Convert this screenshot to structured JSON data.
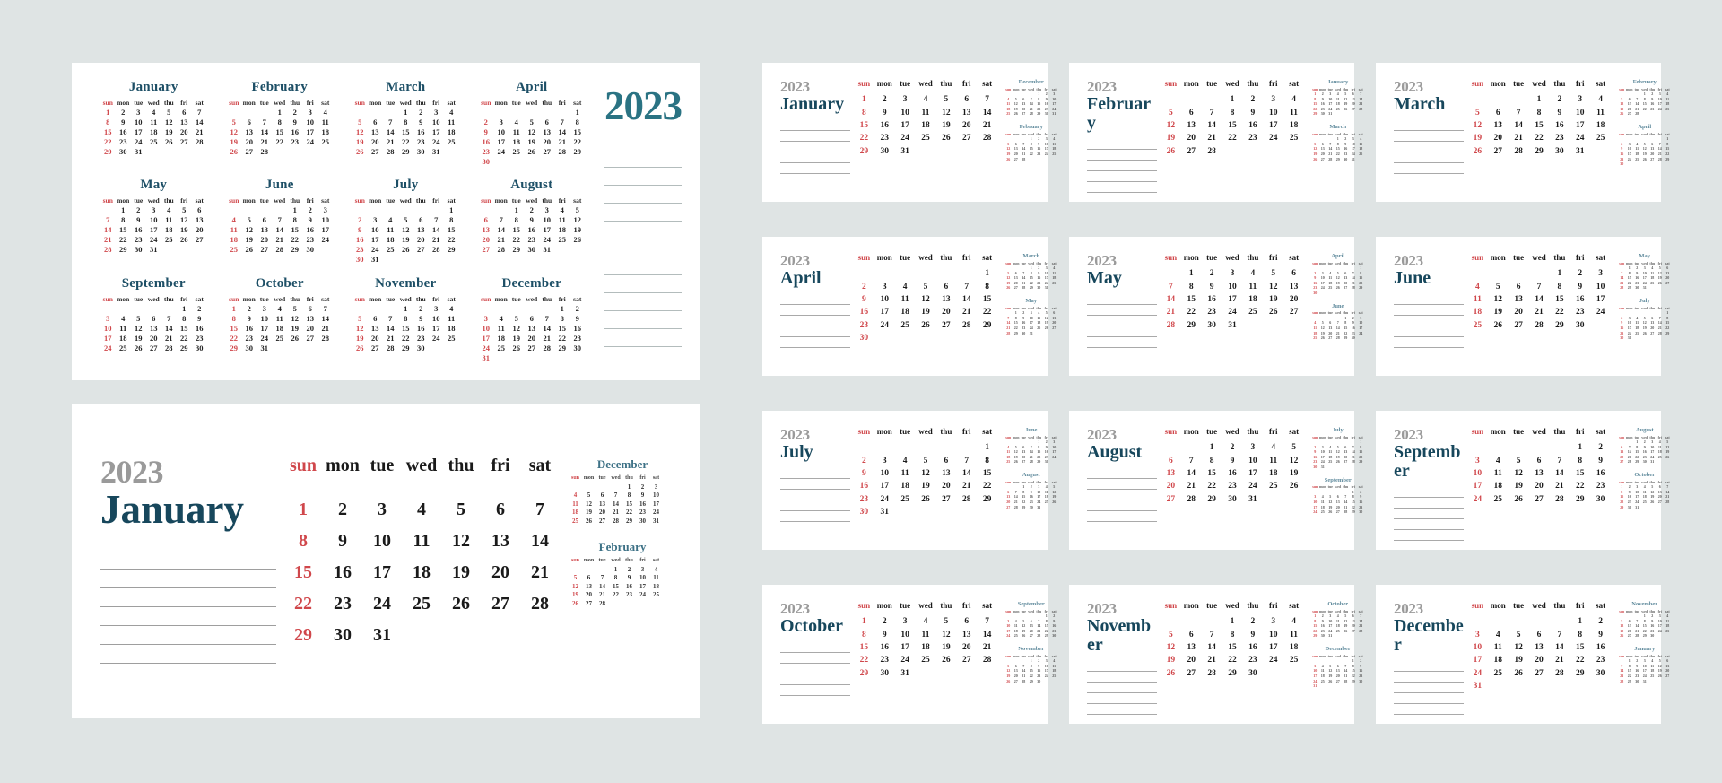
{
  "meta": {
    "year": "2023",
    "background_color": "#dfe4e4",
    "card_color": "#ffffff",
    "accent_teal": "#2a7383",
    "month_title_color": "#17475c",
    "year_gray": "#9a9a9a",
    "sunday_red": "#d0474b"
  },
  "weekday_labels": [
    "sun",
    "mon",
    "tue",
    "wed",
    "thu",
    "fri",
    "sat"
  ],
  "year_overview": {
    "year_label": "2023",
    "note_line_count": 11,
    "months": [
      {
        "name": "January",
        "start": 0,
        "days": 31
      },
      {
        "name": "February",
        "start": 3,
        "days": 28
      },
      {
        "name": "March",
        "start": 3,
        "days": 31
      },
      {
        "name": "April",
        "start": 6,
        "days": 30
      },
      {
        "name": "May",
        "start": 1,
        "days": 31
      },
      {
        "name": "June",
        "start": 4,
        "days": 30
      },
      {
        "name": "July",
        "start": 6,
        "days": 31
      },
      {
        "name": "August",
        "start": 2,
        "days": 31
      },
      {
        "name": "September",
        "start": 5,
        "days": 30
      },
      {
        "name": "October",
        "start": 0,
        "days": 31
      },
      {
        "name": "November",
        "start": 3,
        "days": 30
      },
      {
        "name": "December",
        "start": 5,
        "days": 31
      }
    ]
  },
  "big_month": {
    "year_label": "2023",
    "month_label": "January",
    "start": 0,
    "days": 31,
    "note_line_count": 6,
    "side_calendars": [
      {
        "name": "December",
        "start": 4,
        "days": 31
      },
      {
        "name": "February",
        "start": 3,
        "days": 28
      }
    ]
  },
  "month_cards": [
    {
      "year_label": "2023",
      "month_label": "January",
      "start": 0,
      "days": 31,
      "note_line_count": 5,
      "side_calendars": [
        {
          "name": "December",
          "start": 4,
          "days": 31
        },
        {
          "name": "February",
          "start": 3,
          "days": 28
        }
      ]
    },
    {
      "year_label": "2023",
      "month_label": "February",
      "start": 3,
      "days": 28,
      "note_line_count": 5,
      "side_calendars": [
        {
          "name": "January",
          "start": 0,
          "days": 31
        },
        {
          "name": "March",
          "start": 3,
          "days": 31
        }
      ]
    },
    {
      "year_label": "2023",
      "month_label": "March",
      "start": 3,
      "days": 31,
      "note_line_count": 5,
      "side_calendars": [
        {
          "name": "February",
          "start": 3,
          "days": 28
        },
        {
          "name": "April",
          "start": 6,
          "days": 30
        }
      ]
    },
    {
      "year_label": "2023",
      "month_label": "April",
      "start": 6,
      "days": 30,
      "note_line_count": 5,
      "side_calendars": [
        {
          "name": "March",
          "start": 3,
          "days": 31
        },
        {
          "name": "May",
          "start": 1,
          "days": 31
        }
      ]
    },
    {
      "year_label": "2023",
      "month_label": "May",
      "start": 1,
      "days": 31,
      "note_line_count": 5,
      "side_calendars": [
        {
          "name": "April",
          "start": 6,
          "days": 30
        },
        {
          "name": "June",
          "start": 4,
          "days": 30
        }
      ]
    },
    {
      "year_label": "2023",
      "month_label": "June",
      "start": 4,
      "days": 30,
      "note_line_count": 5,
      "side_calendars": [
        {
          "name": "May",
          "start": 1,
          "days": 31
        },
        {
          "name": "July",
          "start": 6,
          "days": 31
        }
      ]
    },
    {
      "year_label": "2023",
      "month_label": "July",
      "start": 6,
      "days": 31,
      "note_line_count": 5,
      "side_calendars": [
        {
          "name": "June",
          "start": 4,
          "days": 30
        },
        {
          "name": "August",
          "start": 2,
          "days": 31
        }
      ]
    },
    {
      "year_label": "2023",
      "month_label": "August",
      "start": 2,
      "days": 31,
      "note_line_count": 5,
      "side_calendars": [
        {
          "name": "July",
          "start": 6,
          "days": 31
        },
        {
          "name": "September",
          "start": 5,
          "days": 30
        }
      ]
    },
    {
      "year_label": "2023",
      "month_label": "September",
      "start": 5,
      "days": 30,
      "note_line_count": 5,
      "side_calendars": [
        {
          "name": "August",
          "start": 2,
          "days": 31
        },
        {
          "name": "October",
          "start": 0,
          "days": 31
        }
      ]
    },
    {
      "year_label": "2023",
      "month_label": "October",
      "start": 0,
      "days": 31,
      "note_line_count": 5,
      "side_calendars": [
        {
          "name": "September",
          "start": 5,
          "days": 30
        },
        {
          "name": "November",
          "start": 3,
          "days": 30
        }
      ]
    },
    {
      "year_label": "2023",
      "month_label": "November",
      "start": 3,
      "days": 30,
      "note_line_count": 5,
      "side_calendars": [
        {
          "name": "October",
          "start": 0,
          "days": 31
        },
        {
          "name": "December",
          "start": 5,
          "days": 31
        }
      ]
    },
    {
      "year_label": "2023",
      "month_label": "December",
      "start": 5,
      "days": 31,
      "note_line_count": 5,
      "side_calendars": [
        {
          "name": "November",
          "start": 3,
          "days": 30
        },
        {
          "name": "January",
          "start": 1,
          "days": 31
        }
      ]
    }
  ]
}
